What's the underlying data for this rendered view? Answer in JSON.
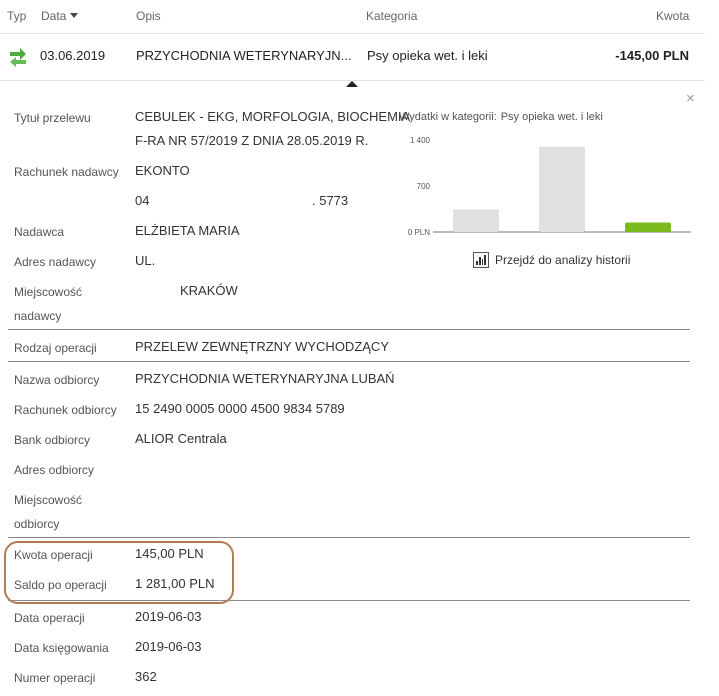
{
  "header": {
    "typ": "Typ",
    "data": "Data",
    "opis": "Opis",
    "kategoria": "Kategoria",
    "kwota": "Kwota"
  },
  "transaction": {
    "date": "03.06.2019",
    "description": "PRZYCHODNIA WETERYNARYJN...",
    "category": "Psy opieka wet. i leki",
    "amount": "-145,00 PLN",
    "type_icon": "transfer-arrows-icon",
    "type_icon_color": "#4caf3b"
  },
  "close_label": "×",
  "details": {
    "tytul": {
      "label": "Tytuł przelewu",
      "line1": "CEBULEK - EKG, MORFOLOGIA, BIOCHEMIA",
      "line2": "F-RA NR 57/2019 Z DNIA 28.05.2019 R."
    },
    "rachunek_nadawcy": {
      "label": "Rachunek nadawcy",
      "line1": "EKONTO",
      "line2a": "04",
      "line2b": ". 5773"
    },
    "nadawca": {
      "label": "Nadawca",
      "value": "ELŻBIETA MARIA"
    },
    "adres_nadawcy": {
      "label": "Adres nadawcy",
      "value": "UL."
    },
    "miejscowosc_nadawcy": {
      "label1": "Miejscowość",
      "label2": "nadawcy",
      "value": "KRAKÓW"
    },
    "rodzaj_operacji": {
      "label": "Rodzaj operacji",
      "value": "PRZELEW ZEWNĘTRZNY WYCHODZĄCY"
    },
    "nazwa_odbiorcy": {
      "label": "Nazwa odbiorcy",
      "value": "PRZYCHODNIA WETERYNARYJNA LUBAŃ"
    },
    "rachunek_odbiorcy": {
      "label": "Rachunek odbiorcy",
      "value": "15 2490 0005 0000 4500 9834 5789"
    },
    "bank_odbiorcy": {
      "label": "Bank odbiorcy",
      "value": "ALIOR Centrala"
    },
    "adres_odbiorcy": {
      "label": "Adres odbiorcy",
      "value": ""
    },
    "miejscowosc_odbiorcy": {
      "label1": "Miejscowość",
      "label2": "odbiorcy",
      "value": ""
    },
    "kwota_operacji": {
      "label": "Kwota operacji",
      "value": "145,00 PLN"
    },
    "saldo": {
      "label": "Saldo po operacji",
      "value": "1 281,00 PLN"
    },
    "data_operacji": {
      "label": "Data operacji",
      "value": "2019-06-03"
    },
    "data_ksiegowania": {
      "label": "Data księgowania",
      "value": "2019-06-03"
    },
    "numer_operacji": {
      "label": "Numer operacji",
      "value": "362"
    }
  },
  "chart": {
    "title": "Wydatki w kategorii:",
    "category": "Psy opieka wet. i leki",
    "analysis_link": "Przejdź do analizy historii",
    "bar_color_past": "#e0e0e0",
    "bar_color_current": "#7cbb1e",
    "highlight_color": "#b47a55"
  },
  "chart_data": {
    "type": "bar",
    "yticks": [
      "1 400",
      "700",
      "0 PLN"
    ],
    "ylim": [
      0,
      1400
    ],
    "values": [
      345,
      1300,
      145
    ],
    "grid": false
  }
}
